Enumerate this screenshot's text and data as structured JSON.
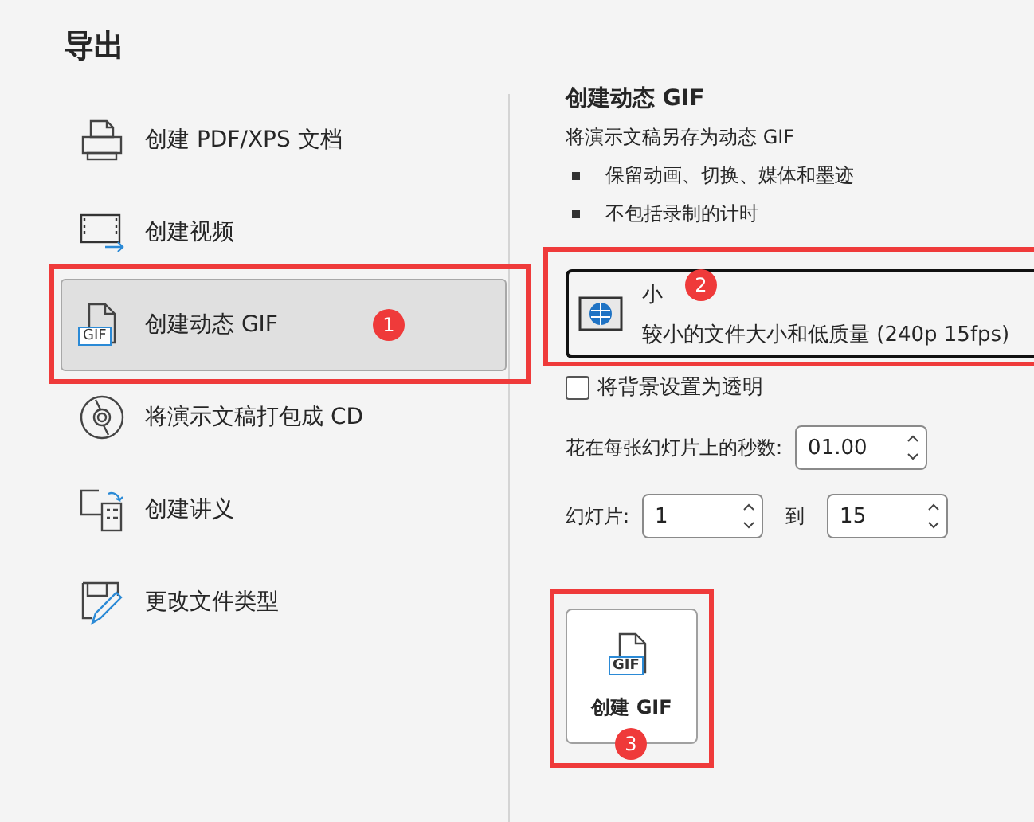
{
  "title": "导出",
  "sidebar": {
    "items": [
      {
        "label": "创建 PDF/XPS 文档",
        "kind": "pdf",
        "selected": false
      },
      {
        "label": "创建视频",
        "kind": "video",
        "selected": false
      },
      {
        "label": "创建动态 GIF",
        "kind": "gif",
        "icon_text": "GIF",
        "selected": true,
        "callout": "1"
      },
      {
        "label": "将演示文稿打包成 CD",
        "kind": "cd",
        "selected": false
      },
      {
        "label": "创建讲义",
        "kind": "handout",
        "selected": false
      },
      {
        "label": "更改文件类型",
        "kind": "filetype",
        "selected": false
      }
    ]
  },
  "panel": {
    "heading": "创建动态 GIF",
    "description": "将演示文稿另存为动态 GIF",
    "bullets": [
      "保留动画、切换、媒体和墨迹",
      "不包括录制的计时"
    ],
    "quality": {
      "name": "小",
      "detail": "较小的文件大小和低质量 (240p 15fps)",
      "callout": "2"
    },
    "transparent": {
      "label": "将背景设置为透明",
      "checked": false
    },
    "seconds": {
      "label": "花在每张幻灯片上的秒数:",
      "value": "01.00"
    },
    "slides": {
      "label": "幻灯片:",
      "from": "1",
      "to_label": "到",
      "to": "15"
    },
    "button": {
      "icon_text": "GIF",
      "label": "创建 GIF",
      "callout": "3"
    }
  }
}
